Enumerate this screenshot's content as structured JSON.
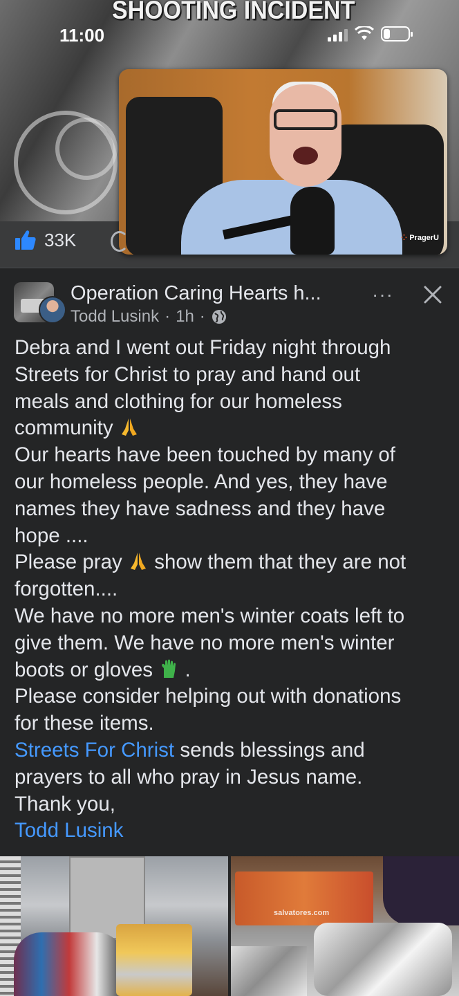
{
  "status_bar": {
    "time": "11:00",
    "battery_level": 0.25
  },
  "video": {
    "headline": "SHOOTING INCIDENT",
    "pip_brand": "PragerU",
    "likes_count": "33K"
  },
  "post": {
    "page_name": "Operation Caring Hearts h...",
    "author": "Todd Lusink",
    "time_ago": "1h",
    "separator": "·",
    "more_label": "···",
    "body": {
      "l1": "Debra and I went out Friday night through",
      "l2": "Streets for Christ to pray and hand out",
      "l3": "meals and clothing for our homeless",
      "l4": "community",
      "l5": "Our hearts have been touched by many of",
      "l6": "our homeless people. And yes, they have",
      "l7": "names they have sadness and they have",
      "l8": "hope ....",
      "l9a": "Please pray",
      "l9b": "show them that they are not",
      "l10": "forgotten....",
      "l11": "We have no more men's winter coats left to",
      "l12": "give them. We have no more men's winter",
      "l13a": "boots or gloves",
      "l13b": ".",
      "l14": "Please consider helping out with donations",
      "l15": "for these items.",
      "l16_link": "Streets For Christ",
      "l16_rest": " sends blessings and",
      "l17": "prayers to all who pray in Jesus name.",
      "l18": "Thank you,",
      "l19_link": "Todd Lusink"
    },
    "photos": {
      "right_label": "salvatores.com"
    }
  },
  "colors": {
    "background": "#242526",
    "text": "#e4e6eb",
    "secondary_text": "#b0b3b8",
    "link": "#4599ff",
    "like_blue": "#2d88ff"
  },
  "icons": [
    "thumbs-up-icon",
    "globe-icon",
    "more-icon",
    "close-icon",
    "pray-emoji-icon",
    "glove-emoji-icon",
    "wifi-icon",
    "signal-icon",
    "battery-icon"
  ]
}
